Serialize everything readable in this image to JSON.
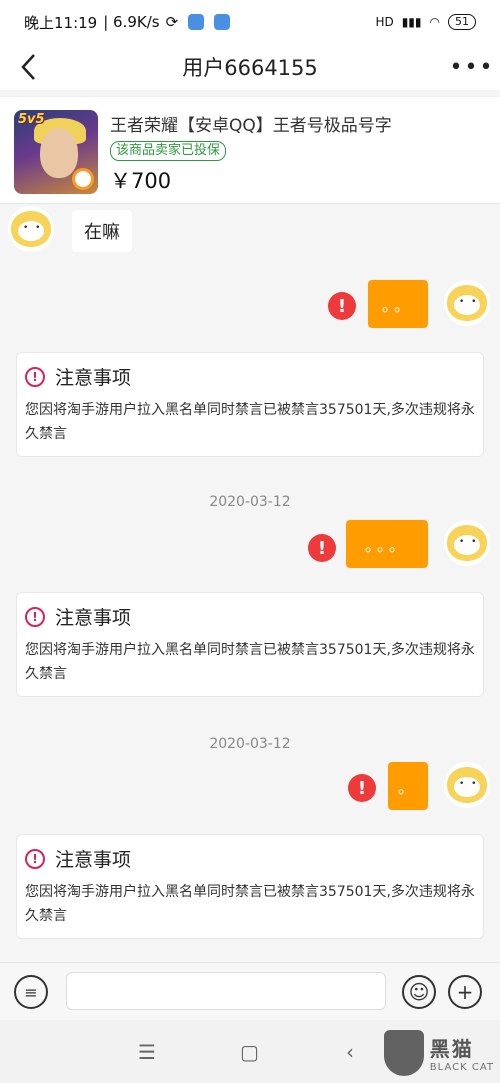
{
  "status_bar": {
    "time": "晚上11:19",
    "speed": "| 6.9K/s",
    "signal": "HD",
    "battery": "51"
  },
  "header": {
    "title": "用户6664155",
    "more_icon": "more-dots-icon"
  },
  "product": {
    "title": "王者荣耀【安卓QQ】王者号极品号字",
    "badge": "该商品卖家已投保",
    "price": "￥700",
    "image_text": "5v5"
  },
  "messages": {
    "incoming_1": "在嘛",
    "outgoing_1": "。。",
    "outgoing_2": "。。。",
    "outgoing_3": "。"
  },
  "notices": [
    {
      "title": "注意事项",
      "body": "您因将淘手游用户拉入黑名单同时禁言已被禁言357501天,多次违规将永久禁言"
    },
    {
      "title": "注意事项",
      "body": "您因将淘手游用户拉入黑名单同时禁言已被禁言357501天,多次违规将永久禁言"
    },
    {
      "title": "注意事项",
      "body": "您因将淘手游用户拉入黑名单同时禁言已被禁言357501天,多次违规将永久禁言"
    }
  ],
  "dates": [
    "2020-03-12",
    "2020-03-12"
  ],
  "input": {
    "placeholder": "",
    "value": ""
  },
  "watermark": {
    "cn": "黑猫",
    "en": "BLACK CAT"
  },
  "colors": {
    "accent": "#ff9d00",
    "error": "#ee3a3a",
    "insured": "#2e9a3f",
    "notice": "#d8235a"
  }
}
